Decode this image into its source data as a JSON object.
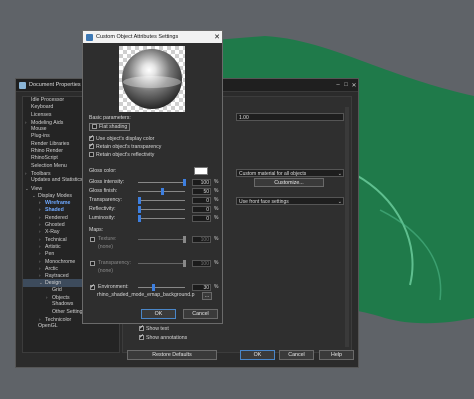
{
  "background": {
    "viewport_color": "#5f6368",
    "object_color": "#1f7a4a"
  },
  "doc_props": {
    "title": "Document Properties",
    "tree": [
      {
        "label": "Idle Processor",
        "indent": 0,
        "arrow": "",
        "state": ""
      },
      {
        "label": "Keyboard",
        "indent": 0,
        "arrow": "",
        "state": ""
      },
      {
        "label": "Licenses",
        "indent": 0,
        "arrow": "",
        "state": ""
      },
      {
        "label": "Modeling Aids",
        "indent": 0,
        "arrow": ">",
        "state": ""
      },
      {
        "label": "Mouse",
        "indent": 0,
        "arrow": "",
        "state": ""
      },
      {
        "label": "Plug-ins",
        "indent": 0,
        "arrow": "",
        "state": ""
      },
      {
        "label": "Render Libraries",
        "indent": 0,
        "arrow": "",
        "state": ""
      },
      {
        "label": "Rhino Render",
        "indent": 0,
        "arrow": "",
        "state": ""
      },
      {
        "label": "RhinoScript",
        "indent": 0,
        "arrow": "",
        "state": ""
      },
      {
        "label": "Selection Menu",
        "indent": 0,
        "arrow": "",
        "state": ""
      },
      {
        "label": "Toolbars",
        "indent": 0,
        "arrow": ">",
        "state": ""
      },
      {
        "label": "Updates and Statistics",
        "indent": 0,
        "arrow": "",
        "state": ""
      },
      {
        "label": "View",
        "indent": 0,
        "arrow": "v",
        "state": ""
      },
      {
        "label": "Display Modes",
        "indent": 1,
        "arrow": "v",
        "state": ""
      },
      {
        "label": "Wireframe",
        "indent": 2,
        "arrow": ">",
        "state": "hl"
      },
      {
        "label": "Shaded",
        "indent": 2,
        "arrow": ">",
        "state": "hl"
      },
      {
        "label": "Rendered",
        "indent": 2,
        "arrow": ">",
        "state": ""
      },
      {
        "label": "Ghosted",
        "indent": 2,
        "arrow": ">",
        "state": ""
      },
      {
        "label": "X-Ray",
        "indent": 2,
        "arrow": ">",
        "state": ""
      },
      {
        "label": "Technical",
        "indent": 2,
        "arrow": ">",
        "state": ""
      },
      {
        "label": "Artistic",
        "indent": 2,
        "arrow": ">",
        "state": ""
      },
      {
        "label": "Pen",
        "indent": 2,
        "arrow": ">",
        "state": ""
      },
      {
        "label": "Monochrome",
        "indent": 2,
        "arrow": ">",
        "state": ""
      },
      {
        "label": "Arctic",
        "indent": 2,
        "arrow": ">",
        "state": ""
      },
      {
        "label": "Raytraced",
        "indent": 2,
        "arrow": ">",
        "state": ""
      },
      {
        "label": "Design",
        "indent": 2,
        "arrow": "v",
        "state": "sel"
      },
      {
        "label": "Grid",
        "indent": 3,
        "arrow": "",
        "state": ""
      },
      {
        "label": "Objects",
        "indent": 3,
        "arrow": ">",
        "state": ""
      },
      {
        "label": "Shadows",
        "indent": 3,
        "arrow": "",
        "state": ""
      },
      {
        "label": "Other Settings",
        "indent": 3,
        "arrow": "",
        "state": ""
      },
      {
        "label": "Technicolor",
        "indent": 2,
        "arrow": ">",
        "state": ""
      },
      {
        "label": "OpenGL",
        "indent": 1,
        "arrow": "",
        "state": ""
      }
    ],
    "field_value": "1.00",
    "material_dropdown": "Custom material for all objects",
    "customize_button": "Customize...",
    "backface_dropdown": "Use front face settings",
    "show_text": "Show text",
    "show_annotations": "Show annotations",
    "restore_defaults": "Restore Defaults",
    "ok": "OK",
    "cancel": "Cancel",
    "help": "Help"
  },
  "custom_obj": {
    "title": "Custom Object Attributes Settings",
    "basic_params": "Basic parameters:",
    "flat_shading": "Flat shading",
    "use_display_color": "Use object's display color",
    "retain_transparency": "Retain object's transparency",
    "retain_reflectivity": "Retain object's reflectivity",
    "checks": {
      "flat_shading": false,
      "use_display_color": true,
      "retain_transparency": true,
      "retain_reflectivity": false
    },
    "gloss_color_label": "Gloss color:",
    "gloss_color": "#ffffff",
    "params": [
      {
        "key": "gloss_intensity",
        "label": "Gloss intensity:",
        "value": "100",
        "fraction": 1.0
      },
      {
        "key": "gloss_finish",
        "label": "Gloss finish:",
        "value": "50",
        "fraction": 0.5
      },
      {
        "key": "transparency",
        "label": "Transparency:",
        "value": "0",
        "fraction": 0.0
      },
      {
        "key": "reflectivity",
        "label": "Reflectivity:",
        "value": "0",
        "fraction": 0.0
      },
      {
        "key": "luminosity",
        "label": "Luminosity:",
        "value": "0",
        "fraction": 0.0
      }
    ],
    "maps_label": "Maps:",
    "texture_label": "Texture:",
    "texture_value": "100",
    "texture_name": "(none)",
    "transparency_map_label": "Transparency:",
    "transparency_map_value": "100",
    "transparency_map_name": "(none)",
    "environment_label": "Environment:",
    "environment_value": "30",
    "environment_fraction": 0.3,
    "environment_file": "rhino_shaded_mode_emap_background.p",
    "browse": "...",
    "pct": "%",
    "ok": "OK",
    "cancel": "Cancel"
  }
}
